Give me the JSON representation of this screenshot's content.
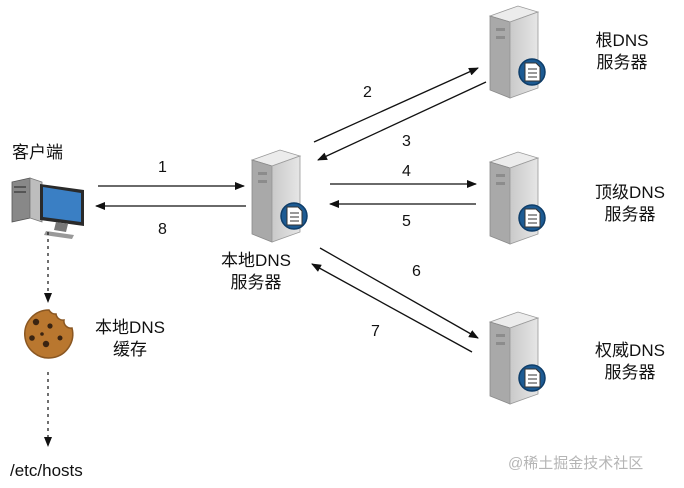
{
  "nodes": {
    "client": "客户端",
    "local_dns": [
      "本地DNS",
      "服务器"
    ],
    "root_dns": [
      "根DNS",
      "服务器"
    ],
    "tld_dns": [
      "顶级DNS",
      "服务器"
    ],
    "auth_dns": [
      "权威DNS",
      "服务器"
    ],
    "local_cache": [
      "本地DNS",
      "缓存"
    ],
    "hosts_file": "/etc/hosts"
  },
  "steps": [
    "1",
    "2",
    "3",
    "4",
    "5",
    "6",
    "7",
    "8"
  ],
  "watermark": "@稀土掘金技术社区",
  "colors": {
    "server_body": "#d3d3d3",
    "badge": "#1d5b93",
    "monitor": "#2f6fb0",
    "cookie": "#b9772f"
  }
}
